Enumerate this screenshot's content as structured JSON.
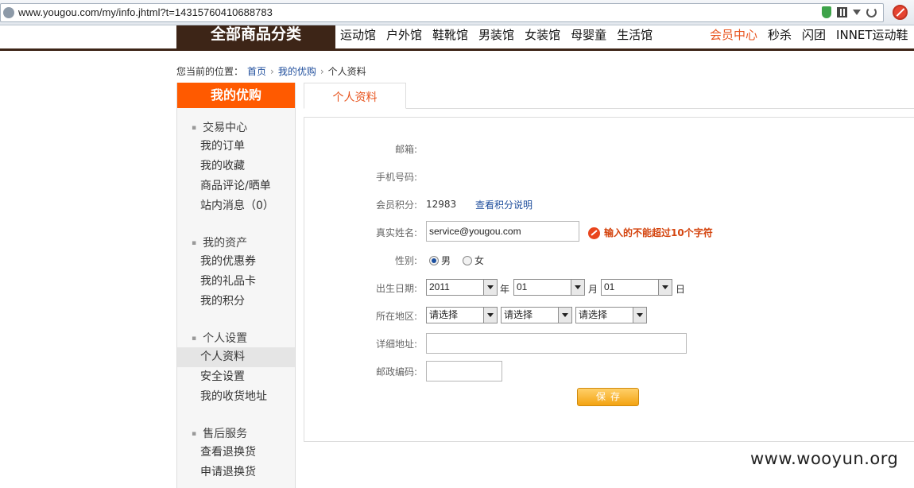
{
  "browser": {
    "url": "www.yougou.com/my/info.jhtml?t=14315760410688783"
  },
  "nav": {
    "category": "全部商品分类",
    "links": [
      "运动馆",
      "户外馆",
      "鞋靴馆",
      "男装馆",
      "女装馆",
      "母婴童",
      "生活馆"
    ],
    "right_links": [
      "会员中心",
      "秒杀",
      "闪团",
      "INNET运动鞋"
    ]
  },
  "breadcrumb": {
    "prefix": "您当前的位置：",
    "home": "首页",
    "my": "我的优购",
    "current": "个人资料",
    "sep": "›"
  },
  "sidebar": {
    "title": "我的优购",
    "sections": [
      {
        "heading": "交易中心",
        "items": [
          "我的订单",
          "我的收藏",
          "商品评论/晒单",
          "站内消息（0）"
        ]
      },
      {
        "heading": "我的资产",
        "items": [
          "我的优惠券",
          "我的礼品卡",
          "我的积分"
        ]
      },
      {
        "heading": "个人设置",
        "items": [
          "个人资料",
          "安全设置",
          "我的收货地址"
        ]
      },
      {
        "heading": "售后服务",
        "items": [
          "查看退换货",
          "申请退换货"
        ]
      }
    ]
  },
  "tab": {
    "label": "个人资料"
  },
  "form": {
    "email_label": "邮箱:",
    "phone_label": "手机号码:",
    "points_label": "会员积分:",
    "points_value": "12983",
    "points_link": "查看积分说明",
    "name_label": "真实姓名:",
    "name_value": "service@yougou.com",
    "name_error": "输入的不能超过10个字符",
    "gender_label": "性别:",
    "gender_male": "男",
    "gender_female": "女",
    "birth_label": "出生日期:",
    "birth_year": "2011",
    "birth_year_unit": "年",
    "birth_month": "01",
    "birth_month_unit": "月",
    "birth_day": "01",
    "birth_day_unit": "日",
    "region_label": "所在地区:",
    "region_province": "请选择",
    "region_city": "请选择",
    "region_district": "请选择",
    "address_label": "详细地址:",
    "address_value": "",
    "zip_label": "邮政编码:",
    "zip_value": "",
    "save_label": "保存"
  },
  "watermark": "www.wooyun.org"
}
